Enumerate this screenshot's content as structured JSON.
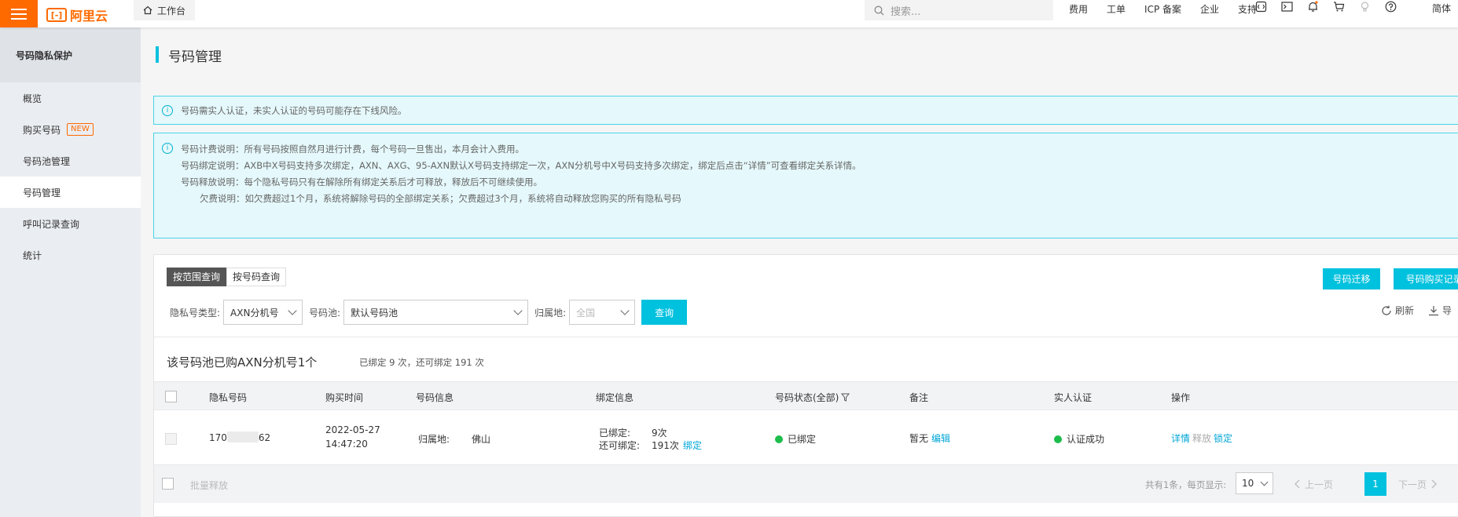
{
  "topbar": {
    "logo_text": "阿里云",
    "workbench": "工作台",
    "search_placeholder": "搜索...",
    "nav": [
      "费用",
      "工单",
      "ICP 备案",
      "企业",
      "支持"
    ],
    "lang": "简体",
    "accent": "#ff6a00"
  },
  "sidebar": {
    "title": "号码隐私保护",
    "items": [
      {
        "label": "概览"
      },
      {
        "label": "购买号码",
        "badge": "NEW"
      },
      {
        "label": "号码池管理"
      },
      {
        "label": "号码管理"
      },
      {
        "label": "呼叫记录查询"
      },
      {
        "label": "统计"
      }
    ]
  },
  "page": {
    "title": "号码管理",
    "notice1": "号码需实人认证，未实人认证的号码可能存在下线风险。",
    "notice2": [
      "号码计费说明：所有号码按照自然月进行计费，每个号码一旦售出，本月会计入费用。",
      "号码绑定说明：AXB中X号码支持多次绑定，AXN、AXG、95-AXN默认X号码支持绑定一次，AXN分机号中X号码支持多次绑定，绑定后点击“详情”可查看绑定关系详情。",
      "号码释放说明：每个隐私号码只有在解除所有绑定关系后才可释放，释放后不可继续使用。",
      "欠费说明：如欠费超过1个月，系统将解除号码的全部绑定关系；欠费超过3个月，系统将自动释放您购买的所有隐私号码"
    ]
  },
  "query": {
    "tabs": [
      "按范围查询",
      "按号码查询"
    ],
    "type_label": "隐私号类型:",
    "type_value": "AXN分机号",
    "pool_label": "号码池:",
    "pool_value": "默认号码池",
    "region_label": "归属地:",
    "region_placeholder": "全国",
    "query_button": "查询",
    "migrate_button": "号码迁移",
    "purchase_record_button": "号码购买记录",
    "refresh": "刷新",
    "export": "导"
  },
  "summary": {
    "title": "该号码池已购AXN分机号1个",
    "sub": "已绑定 9 次，还可绑定 191 次"
  },
  "table": {
    "headers": [
      "隐私号码",
      "购买时间",
      "号码信息",
      "绑定信息",
      "号码状态(全部)",
      "备注",
      "实人认证",
      "操作"
    ],
    "rows": [
      {
        "number_prefix": "170",
        "number_suffix": "62",
        "date": "2022-05-27",
        "time": "14:47:20",
        "region_label": "归属地:",
        "region": "佛山",
        "bound_label": "已绑定:",
        "bound": "9次",
        "remain_label": "还可绑定:",
        "remain": "191次",
        "bind_link": "绑定",
        "status": "已绑定",
        "remark": "暂无",
        "edit": "编辑",
        "auth": "认证成功",
        "ops": [
          "详情",
          "释放",
          "锁定"
        ]
      }
    ]
  },
  "footer": {
    "batch_release": "批量释放",
    "total": "共有1条，每页显示:",
    "page_size": "10",
    "prev": "上一页",
    "page": "1",
    "next": "下一页"
  }
}
